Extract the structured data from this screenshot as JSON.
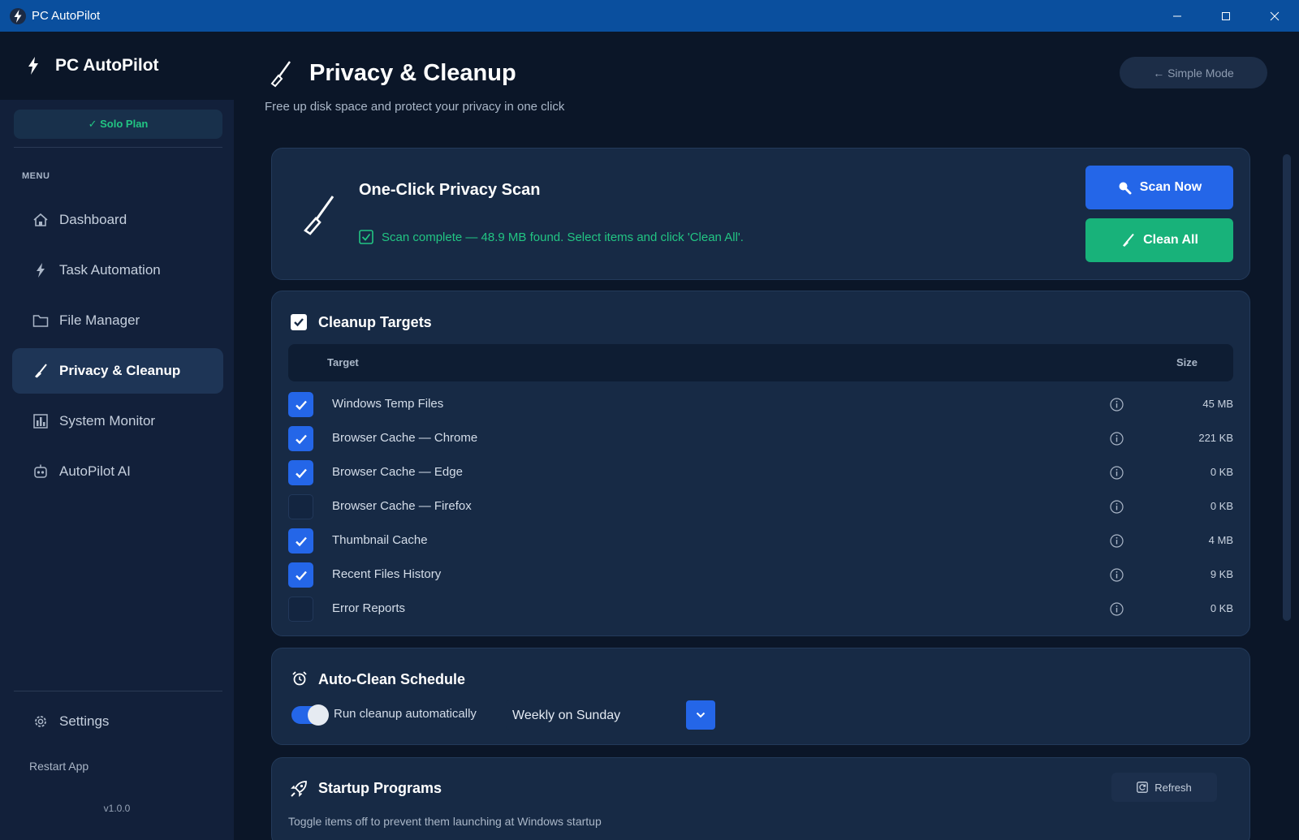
{
  "window": {
    "title": "PC AutoPilot"
  },
  "sidebar": {
    "brand": "PC AutoPilot",
    "plan": "✓ Solo Plan",
    "menu_label": "MENU",
    "items": [
      {
        "label": "Dashboard",
        "icon": "home-icon"
      },
      {
        "label": "Task Automation",
        "icon": "bolt-icon"
      },
      {
        "label": "File Manager",
        "icon": "folder-icon"
      },
      {
        "label": "Privacy & Cleanup",
        "icon": "broom-icon",
        "active": true
      },
      {
        "label": "System Monitor",
        "icon": "chart-icon"
      },
      {
        "label": "AutoPilot AI",
        "icon": "robot-icon"
      }
    ],
    "settings": "Settings",
    "restart": "Restart App",
    "version": "v1.0.0"
  },
  "header": {
    "title": "Privacy & Cleanup",
    "subtitle": "Free up disk space and protect your privacy in one click",
    "simple_mode": "← Simple Mode"
  },
  "scan": {
    "title": "One-Click Privacy Scan",
    "status": "Scan complete — 48.9 MB found. Select items and click 'Clean All'.",
    "scan_button": "Scan Now",
    "clean_button": "Clean All"
  },
  "targets": {
    "title": "Cleanup Targets",
    "col_target": "Target",
    "col_size": "Size",
    "rows": [
      {
        "label": "Windows Temp Files",
        "size": "45 MB",
        "checked": true
      },
      {
        "label": "Browser Cache — Chrome",
        "size": "221 KB",
        "checked": true
      },
      {
        "label": "Browser Cache — Edge",
        "size": "0 KB",
        "checked": true
      },
      {
        "label": "Browser Cache — Firefox",
        "size": "0 KB",
        "checked": false
      },
      {
        "label": "Thumbnail Cache",
        "size": "4 MB",
        "checked": true
      },
      {
        "label": "Recent Files History",
        "size": "9 KB",
        "checked": true
      },
      {
        "label": "Error Reports",
        "size": "0 KB",
        "checked": false
      }
    ]
  },
  "schedule": {
    "title": "Auto-Clean Schedule",
    "toggle_label": "Run cleanup automatically",
    "toggle_on": true,
    "frequency": "Weekly on Sunday"
  },
  "startup": {
    "title": "Startup Programs",
    "refresh": "Refresh",
    "subtitle": "Toggle items off to prevent them launching at Windows startup"
  },
  "colors": {
    "accent_blue": "#2466e8",
    "accent_green": "#18b27a",
    "titlebar": "#0a4f9e"
  }
}
